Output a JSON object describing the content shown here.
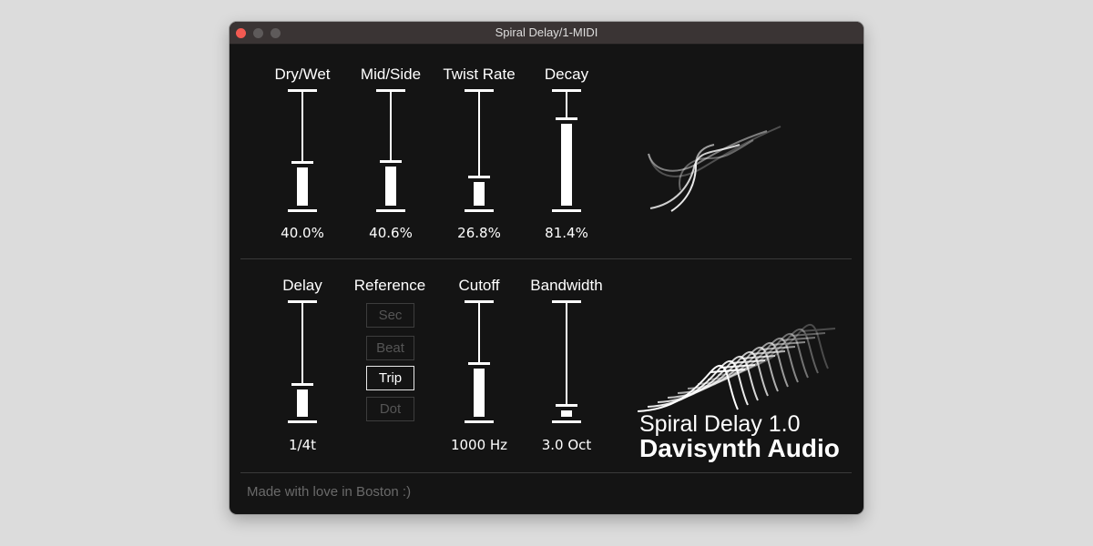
{
  "window": {
    "title": "Spiral Delay/1-MIDI"
  },
  "top_sliders": [
    {
      "label": "Dry/Wet",
      "value": "40.0%",
      "level": 0.4
    },
    {
      "label": "Mid/Side",
      "value": "40.6%",
      "level": 0.406
    },
    {
      "label": "Twist Rate",
      "value": "26.8%",
      "level": 0.268
    },
    {
      "label": "Decay",
      "value": "81.4%",
      "level": 0.814
    }
  ],
  "bottom": {
    "delay": {
      "label": "Delay",
      "value": "1/4t",
      "level": 0.3
    },
    "reference": {
      "label": "Reference",
      "options": [
        "Sec",
        "Beat",
        "Trip",
        "Dot"
      ],
      "selected": "Trip"
    },
    "cutoff": {
      "label": "Cutoff",
      "value": "1000 Hz",
      "level": 0.5
    },
    "bandwidth": {
      "label": "Bandwidth",
      "value": "3.0 Oct",
      "level": 0.1
    }
  },
  "brand": {
    "product": "Spiral Delay 1.0",
    "company": "Davisynth Audio"
  },
  "footer": "Made with love in Boston :)",
  "colors": {
    "background": "#141414",
    "titlebar": "#3a3434",
    "foreground": "#ffffff",
    "close_button": "#f25a52",
    "inactive": "#555555"
  }
}
